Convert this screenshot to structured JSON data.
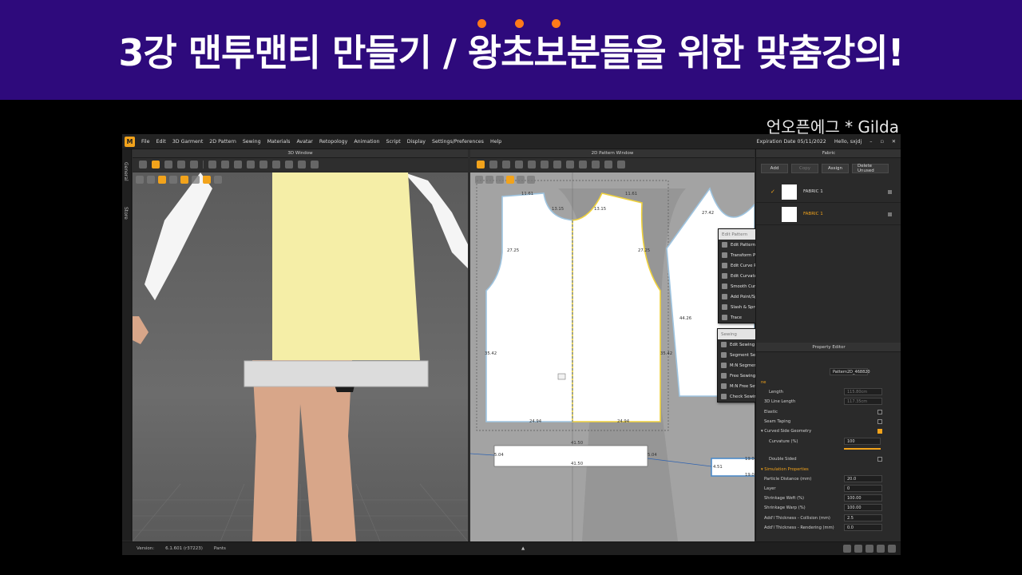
{
  "banner": {
    "title": "3강 맨투맨티 만들기 / 왕초보분들을 위한 맞춤강의!",
    "bg_color": "#2e0a7c",
    "dot_color": "#ff7a1a"
  },
  "brand": {
    "text": "언오픈에그 * Gilda"
  },
  "app": {
    "menu": [
      "File",
      "Edit",
      "3D Garment",
      "2D Pattern",
      "Sewing",
      "Materials",
      "Avatar",
      "Retopology",
      "Animation",
      "Script",
      "Display",
      "Settings/Preferences",
      "Help"
    ],
    "expiration": "Expiration Date 05/11/2022",
    "hello": "Hello, sxjdj",
    "accent_color": "#f2a31b",
    "side_tabs": {
      "general": "General",
      "store": "Store"
    },
    "windows": {
      "window3d_title": "3D Window",
      "window2d_title": "2D Pattern Window",
      "fabric_title": "Fabric",
      "property_title": "Property Editor"
    },
    "fabric": {
      "buttons": {
        "add": "Add",
        "copy": "Copy",
        "assign": "Assign",
        "delete_unused": "Delete Unused"
      },
      "items": [
        {
          "name": "FABRIC 1"
        },
        {
          "name": "FABRIC 1"
        }
      ]
    },
    "edit_pattern_menu": {
      "title": "Edit Pattern",
      "items": [
        "Edit Pattern",
        "Transform Point/Segment",
        "Edit Curve Point",
        "Edit Curvature",
        "Smooth Curve",
        "Add Point/Split Line",
        "Slash & Spread",
        "Trace"
      ]
    },
    "sewing_menu": {
      "title": "Sewing",
      "items": [
        "Edit Sewing",
        "Segment Sewing",
        "M:N Segment Sewing",
        "Free Sewing",
        "M:N Free Sewing",
        "Check Sewing Length"
      ]
    },
    "measures": {
      "m1": "11.61",
      "m2": "13.15",
      "m3": "13.15",
      "m4": "11.61",
      "m5": "27.25",
      "m6": "27.25",
      "m7": "35.42",
      "m8": "35.42",
      "m9": "24.94",
      "m10": "24.94",
      "m11": "27.42",
      "m12": "44.26",
      "m13": "41.50",
      "m14": "41.50",
      "m15": "5.04",
      "m16": "5.04",
      "m17": "4.51",
      "m18": "19.0",
      "m19": "19.0"
    },
    "properties": {
      "name_value": "Pattern2D_468820",
      "line_label": "ne",
      "length_label": "Length",
      "length_value": "115.80cm",
      "line_length_label": "3D Line Length",
      "line_length_value": "117.35cm",
      "elastic": "Elastic",
      "seam_taping": "Seam Taping",
      "curved_side": "Curved Side Geometry",
      "curvature_label": "Curvature (%)",
      "curvature_value": "100",
      "double_sided": "Double Sided",
      "sim_section": "Simulation Properties",
      "particle_label": "Particle Distance (mm)",
      "particle_value": "20.0",
      "layer_label": "Layer",
      "layer_value": "0",
      "weft_label": "Shrinkage Weft (%)",
      "weft_value": "100.00",
      "warp_label": "Shrinkage Warp (%)",
      "warp_value": "100.00",
      "collision_label": "Add'l Thickness - Collision (mm)",
      "collision_value": "2.5",
      "render_label": "Add'l Thickness - Rendering (mm)",
      "render_value": "0.0"
    },
    "status": {
      "version_label": "Version:",
      "version": "6.1.601 (r37223)",
      "object": "Pants"
    }
  }
}
